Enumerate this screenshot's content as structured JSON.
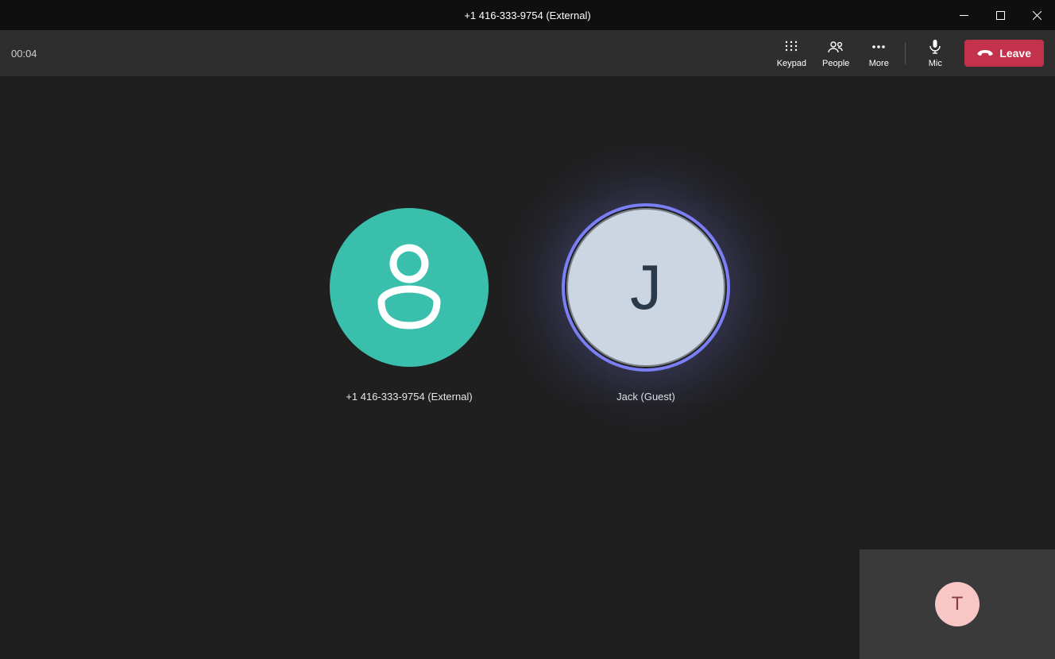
{
  "titlebar": {
    "title": "+1 416-333-9754 (External)"
  },
  "toolbar": {
    "timer": "00:04",
    "keypad_label": "Keypad",
    "people_label": "People",
    "more_label": "More",
    "mic_label": "Mic",
    "leave_label": "Leave"
  },
  "participants": [
    {
      "name": "+1 416-333-9754 (External)",
      "initial": "",
      "avatar_color": "#3bbfad",
      "speaking": false,
      "icon": "person"
    },
    {
      "name": "Jack (Guest)",
      "initial": "J",
      "avatar_color": "#cbd6e2",
      "speaking": true,
      "icon": "initial"
    }
  ],
  "self": {
    "initial": "T",
    "avatar_color": "#f7c6c5"
  },
  "colors": {
    "leave_button": "#c4314b",
    "speaking_ring": "#7a7ff5"
  }
}
